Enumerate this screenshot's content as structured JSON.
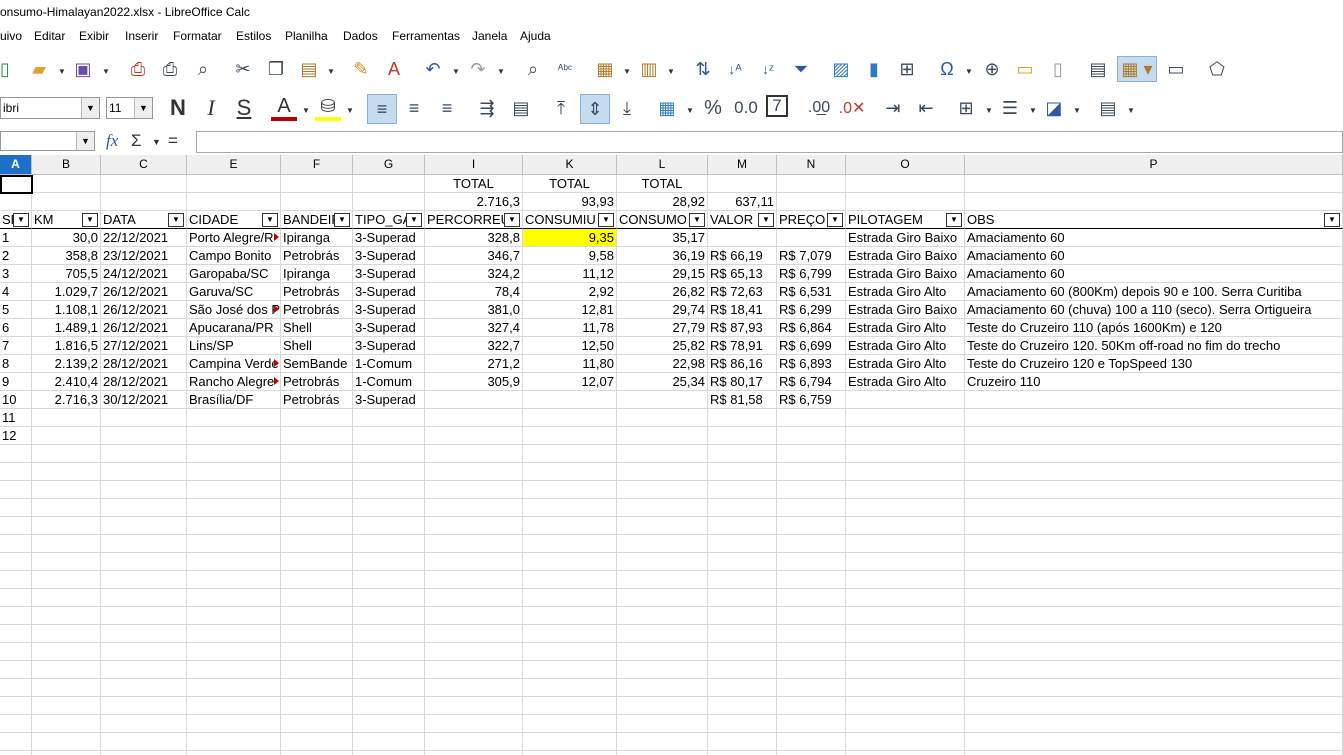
{
  "window": {
    "title": "onsumo-Himalayan2022.xlsx - LibreOffice Calc"
  },
  "menu": [
    "uivo",
    "Editar",
    "Exibir",
    "Inserir",
    "Formatar",
    "Estilos",
    "Planilha",
    "Dados",
    "Ferramentas",
    "Janela",
    "Ajuda"
  ],
  "toolbar": {
    "font_name": "ibri",
    "font_size": "11",
    "bold": "N",
    "italic": "I",
    "underline": "S"
  },
  "formula_bar": {
    "name_box": "",
    "input": ""
  },
  "columns": [
    "A",
    "B",
    "C",
    "E",
    "F",
    "G",
    "I",
    "K",
    "L",
    "M",
    "N",
    "O",
    "P"
  ],
  "active_column": "A",
  "totals_row": {
    "I": "TOTAL",
    "K": "TOTAL",
    "L": "TOTAL"
  },
  "sums_row": {
    "I": "2.716,3",
    "K": "93,93",
    "L": "28,92",
    "M": "637,11"
  },
  "headers": [
    "SE",
    "KM",
    "DATA",
    "CIDADE",
    "BANDEIR",
    "TIPO_GA",
    "PERCORREU",
    "CONSUMIU",
    "CONSUMO",
    "VALOR",
    "PREÇO",
    "PILOTAGEM",
    "OBS"
  ],
  "rows": [
    [
      "1",
      "30,0",
      "22/12/2021",
      "Porto Alegre/R",
      "Ipiranga",
      "3-Superad",
      "328,8",
      "9,35",
      "35,17",
      "",
      "",
      "Estrada Giro Baixo",
      "Amaciamento 60"
    ],
    [
      "2",
      "358,8",
      "23/12/2021",
      "Campo Bonito",
      "Petrobrás",
      "3-Superad",
      "346,7",
      "9,58",
      "36,19",
      "R$  66,19",
      "R$  7,079",
      "Estrada Giro Baixo",
      "Amaciamento 60"
    ],
    [
      "3",
      "705,5",
      "24/12/2021",
      "Garopaba/SC",
      "Ipiranga",
      "3-Superad",
      "324,2",
      "11,12",
      "29,15",
      "R$  65,13",
      "R$  6,799",
      "Estrada Giro Baixo",
      "Amaciamento 60"
    ],
    [
      "4",
      "1.029,7",
      "26/12/2021",
      "Garuva/SC",
      "Petrobrás",
      "3-Superad",
      "78,4",
      "2,92",
      "26,82",
      "R$  72,63",
      "R$  6,531",
      "Estrada Giro Alto",
      "Amaciamento 60 (800Km) depois 90 e 100. Serra Curitiba"
    ],
    [
      "5",
      "1.108,1",
      "26/12/2021",
      "São José dos P",
      "Petrobrás",
      "3-Superad",
      "381,0",
      "12,81",
      "29,74",
      "R$  18,41",
      "R$  6,299",
      "Estrada Giro Baixo",
      "Amaciamento 60 (chuva) 100 a 110 (seco). Serra Ortigueira"
    ],
    [
      "6",
      "1.489,1",
      "26/12/2021",
      "Apucarana/PR",
      "Shell",
      "3-Superad",
      "327,4",
      "11,78",
      "27,79",
      "R$  87,93",
      "R$  6,864",
      "Estrada Giro Alto",
      "Teste do Cruzeiro 110 (após 1600Km) e 120"
    ],
    [
      "7",
      "1.816,5",
      "27/12/2021",
      "Lins/SP",
      "Shell",
      "3-Superad",
      "322,7",
      "12,50",
      "25,82",
      "R$  78,91",
      "R$  6,699",
      "Estrada Giro Alto",
      "Teste do Cruzeiro 120. 50Km off-road no fim do trecho"
    ],
    [
      "8",
      "2.139,2",
      "28/12/2021",
      "Campina Verde",
      "SemBande",
      "1-Comum",
      "271,2",
      "11,80",
      "22,98",
      "R$  86,16",
      "R$  6,893",
      "Estrada Giro Alto",
      "Teste do Cruzeiro 120 e TopSpeed 130"
    ],
    [
      "9",
      "2.410,4",
      "28/12/2021",
      "Rancho Alegre",
      "Petrobrás",
      "1-Comum",
      "305,9",
      "12,07",
      "25,34",
      "R$  80,17",
      "R$  6,794",
      "Estrada Giro Alto",
      "Cruzeiro 110"
    ],
    [
      "10",
      "2.716,3",
      "30/12/2021",
      "Brasília/DF",
      "Petrobrás",
      "3-Superad",
      "",
      "",
      "",
      "R$  81,58",
      "R$  6,759",
      "",
      ""
    ],
    [
      "11",
      "",
      "",
      "",
      "",
      "",
      "",
      "",
      "",
      "",
      "",
      "",
      ""
    ],
    [
      "12",
      "",
      "",
      "",
      "",
      "",
      "",
      "",
      "",
      "",
      "",
      "",
      ""
    ]
  ],
  "highlight_cell": {
    "row": 0,
    "col": 7,
    "color": "#ffff00"
  },
  "icons": [
    "new-icon",
    "open-icon",
    "save-icon",
    "export-pdf-icon",
    "print-icon",
    "print-preview-icon",
    "cut-icon",
    "copy-icon",
    "paste-icon",
    "clone-formatting-icon",
    "clear-formatting-icon",
    "undo-icon",
    "redo-icon",
    "find-replace-icon",
    "spelling-icon",
    "row-icon",
    "column-icon",
    "sort-icon",
    "sort-ascending-icon",
    "sort-descending-icon",
    "autofilter-icon",
    "image-icon",
    "chart-icon",
    "pivot-table-icon",
    "special-character-icon",
    "hyperlink-icon",
    "comment-icon",
    "header-footer-icon",
    "define-print-area-icon",
    "freeze-icon",
    "split-window-icon",
    "show-draw-functions-icon"
  ]
}
